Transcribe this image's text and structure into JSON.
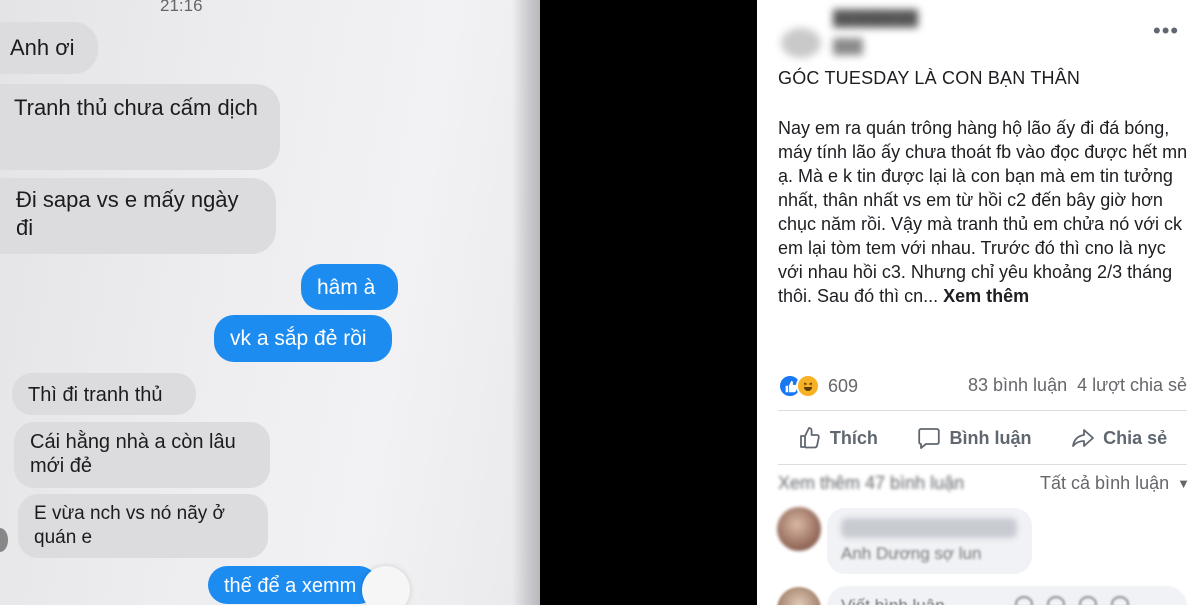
{
  "chat": {
    "time": "21:16",
    "messages": [
      {
        "side": "in",
        "text": "Anh ơi"
      },
      {
        "side": "in",
        "text": "Tranh thủ chưa cấm dịch"
      },
      {
        "side": "in",
        "text": "Đi sapa vs e mấy ngày đi"
      },
      {
        "side": "out",
        "text": "hâm à"
      },
      {
        "side": "out",
        "text": "vk a sắp đẻ rồi"
      },
      {
        "side": "in",
        "text": "Thì đi tranh thủ"
      },
      {
        "side": "in",
        "text": "Cái hằng nhà a còn lâu mới đẻ"
      },
      {
        "side": "in",
        "text": "E vừa nch vs nó nãy ở quán e"
      },
      {
        "side": "out",
        "text": "thế để a xemm"
      }
    ]
  },
  "post": {
    "more_icon": "•••",
    "title": "GÓC TUESDAY LÀ CON BẠN THÂN",
    "body": "Nay em ra quán trông hàng hộ lão ấy đi đá bóng, máy tính lão ấy chưa thoát fb vào đọc được hết mn ạ. Mà e k tin được lại là con bạn mà em tin tưởng nhất, thân nhất vs em từ hồi c2 đến bây giờ hơn chục năm rồi. Vậy mà tranh thủ em chửa nó với ck em lại tòm tem với nhau. Trước đó thì cno là nyc với nhau hồi c3. Nhưng chỉ yêu khoảng 2/3 tháng thôi. Sau đó thì cn... ",
    "see_more": "Xem thêm",
    "reaction_count": "609",
    "comment_count": "83 bình luận",
    "share_count": "4 lượt chia sẻ",
    "actions": {
      "like": "Thích",
      "comment": "Bình luận",
      "share": "Chia sẻ"
    },
    "view_more_comments": "Xem thêm 47 bình luận",
    "comment_filter": "Tất cả bình luận",
    "comment": {
      "text": "Anh Dương sợ lun"
    },
    "composer_placeholder": "Viết bình luận..."
  }
}
